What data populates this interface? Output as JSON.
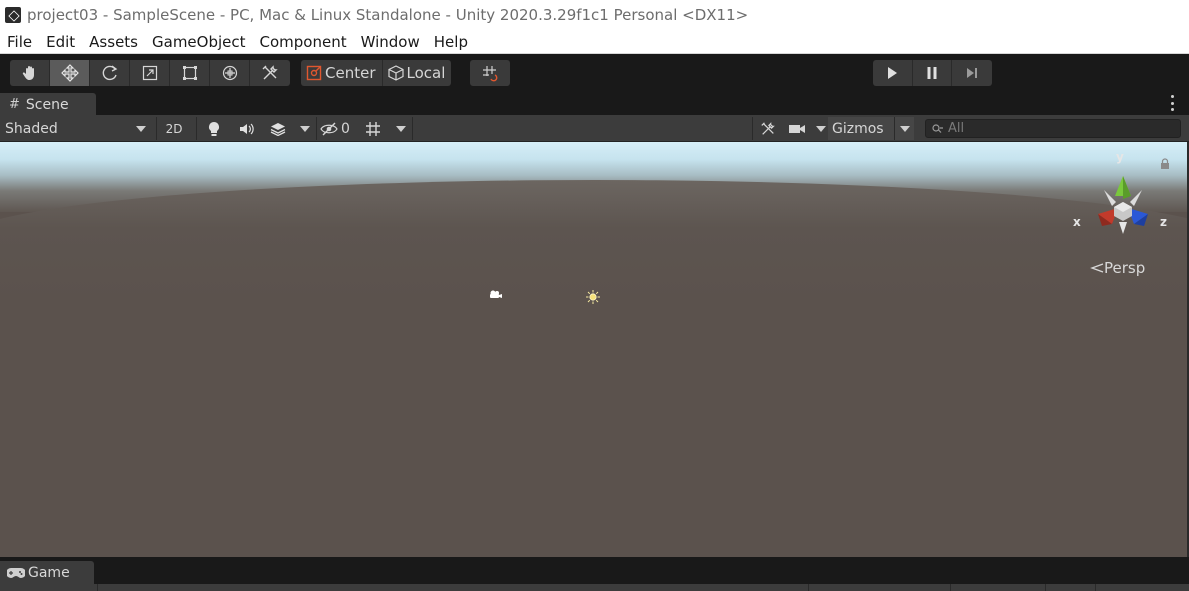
{
  "window": {
    "title": "project03 - SampleScene - PC, Mac & Linux Standalone - Unity 2020.3.29f1c1 Personal <DX11>"
  },
  "menu": [
    "File",
    "Edit",
    "Assets",
    "GameObject",
    "Component",
    "Window",
    "Help"
  ],
  "toolbar": {
    "tools": [
      "hand-tool",
      "move-tool",
      "rotate-tool",
      "scale-tool",
      "rect-tool",
      "transform-tool",
      "custom-tool"
    ],
    "active_tool": "move-tool",
    "pivot_mode": "Center",
    "pivot_rotation": "Local",
    "play_controls": [
      "play",
      "pause",
      "step"
    ]
  },
  "scene_tab": {
    "label": "Scene",
    "draw_mode": "Shaded",
    "toggle_2d": "2D",
    "hidden_count": "0",
    "gizmos_label": "Gizmos",
    "search_placeholder": "All"
  },
  "scene_view": {
    "axis_x": "x",
    "axis_y": "y",
    "axis_z": "z",
    "projection": "Persp"
  },
  "game_tab": {
    "label": "Game"
  },
  "colors": {
    "sky": "#d6eef7",
    "ground": "#5b524d",
    "axis_x": "#c23a2b",
    "axis_y": "#7ac83c",
    "axis_z": "#2a58d6"
  }
}
